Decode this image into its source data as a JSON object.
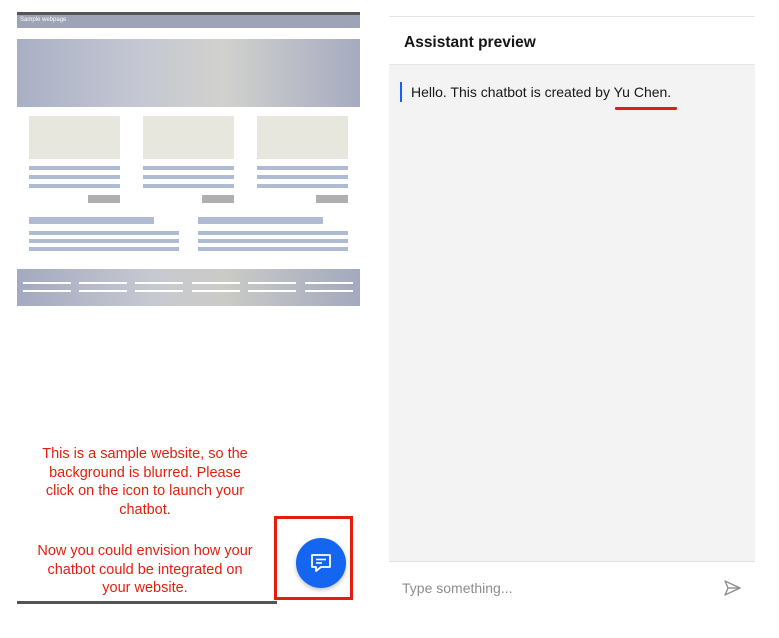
{
  "website": {
    "bar_label": "Sample webpage",
    "note_paragraph_1": [
      "This is a sample website, so the",
      "background is blurred. Please",
      "click on the icon to launch your",
      "chatbot."
    ],
    "note_paragraph_2": [
      "Now you could envision how your",
      "chatbot could be integrated on",
      "your website."
    ],
    "launcher_icon": "chat-icon"
  },
  "assistant": {
    "title": "Assistant preview",
    "message_prefix": "Hello. This chatbot is created by ",
    "message_name": "Yu Chen.",
    "input_placeholder": "Type something...",
    "send_icon": "send-icon"
  },
  "colors": {
    "accent": "#0f62fe",
    "launcher": "#1466f0",
    "annotation_red": "#e41e0e"
  }
}
